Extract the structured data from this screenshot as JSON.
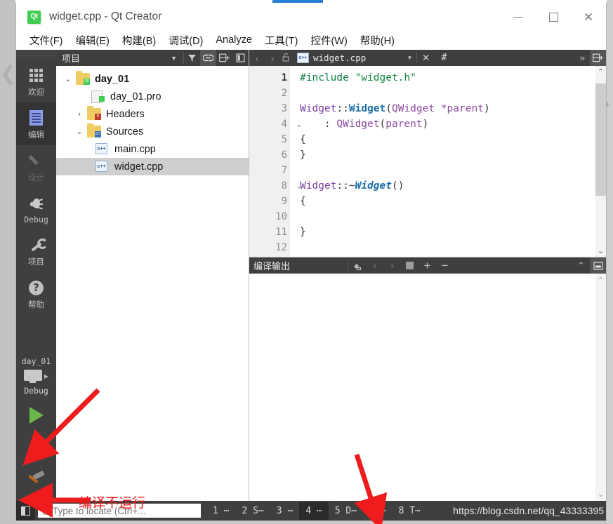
{
  "window": {
    "title": "widget.cpp - Qt Creator",
    "logo_text": "Qt",
    "minimize": "—",
    "maximize": "□",
    "close": "✕"
  },
  "menubar": {
    "items": [
      {
        "label": "文件(F)"
      },
      {
        "label": "编辑(E)"
      },
      {
        "label": "构建(B)"
      },
      {
        "label": "调试(D)"
      },
      {
        "label": "Analyze"
      },
      {
        "label": "工具(T)"
      },
      {
        "label": "控件(W)"
      },
      {
        "label": "帮助(H)"
      }
    ]
  },
  "modebar": {
    "modes": [
      {
        "label": "欢迎",
        "icon": "grid-icon",
        "state": "normal"
      },
      {
        "label": "编辑",
        "icon": "document-icon",
        "state": "active"
      },
      {
        "label": "设计",
        "icon": "pencil-icon",
        "state": "disabled"
      },
      {
        "label": "Debug",
        "icon": "bug-icon",
        "state": "normal"
      },
      {
        "label": "项目",
        "icon": "wrench-icon",
        "state": "normal"
      },
      {
        "label": "帮助",
        "icon": "question-circle-icon",
        "state": "normal"
      }
    ],
    "kit": {
      "project": "day_01",
      "target_icon": "monitor-icon",
      "build_config": "Debug",
      "run_label": "运行",
      "debug_label": "开始调试",
      "build_label": "构建"
    }
  },
  "project_panel": {
    "title": "项目",
    "toolbar": [
      {
        "name": "filter-icon",
        "label": "▼"
      },
      {
        "name": "link-icon",
        "label": "⛓",
        "active": true
      },
      {
        "name": "split-add-icon",
        "label": "⊟+"
      },
      {
        "name": "collapse-icon",
        "label": "◧"
      }
    ],
    "tree": [
      {
        "indent": 0,
        "twisty": "⌄",
        "icon": "folder-qt-icon",
        "label": "day_01",
        "bold": true,
        "selected": false
      },
      {
        "indent": 1,
        "twisty": "",
        "icon": "file-pro-icon",
        "label": "day_01.pro",
        "bold": false,
        "selected": false
      },
      {
        "indent": 1,
        "twisty": "›",
        "icon": "folder-h-icon",
        "label": "Headers",
        "bold": false,
        "selected": false
      },
      {
        "indent": 1,
        "twisty": "⌄",
        "icon": "folder-cpp-icon",
        "label": "Sources",
        "bold": false,
        "selected": false
      },
      {
        "indent": 2,
        "twisty": "",
        "icon": "file-cpp-icon",
        "label": "main.cpp",
        "bold": false,
        "selected": false
      },
      {
        "indent": 2,
        "twisty": "",
        "icon": "file-cpp-icon",
        "label": "widget.cpp",
        "bold": false,
        "selected": true
      }
    ]
  },
  "editor": {
    "toolbar": {
      "back": "‹",
      "forward": "›",
      "lock_icon": "unlock-icon",
      "file_icon": "cpp-file-icon",
      "filename": "widget.cpp",
      "dropdown": "▾",
      "close": "✕",
      "symbol": "#",
      "overflow": "»",
      "split": "⊟+"
    },
    "lines": [
      {
        "num": "1",
        "fold": "",
        "current": true,
        "tokens": [
          {
            "t": "#include ",
            "c": "k-pre"
          },
          {
            "t": "\"widget.h\"",
            "c": "k-str"
          }
        ]
      },
      {
        "num": "2",
        "fold": "",
        "current": false,
        "tokens": []
      },
      {
        "num": "3",
        "fold": "",
        "current": false,
        "tokens": [
          {
            "t": "Widget",
            "c": "k-type"
          },
          {
            "t": "::",
            "c": "k-op"
          },
          {
            "t": "Widget",
            "c": "k-fn"
          },
          {
            "t": "(",
            "c": "k-pl"
          },
          {
            "t": "QWidget ",
            "c": "k-arg"
          },
          {
            "t": "*parent",
            "c": "k-arg"
          },
          {
            "t": ")",
            "c": "k-pl"
          }
        ]
      },
      {
        "num": "4",
        "fold": "⌄",
        "current": false,
        "tokens": [
          {
            "t": "    : ",
            "c": "k-op"
          },
          {
            "t": "QWidget",
            "c": "k-arg"
          },
          {
            "t": "(",
            "c": "k-pl"
          },
          {
            "t": "parent",
            "c": "k-arg"
          },
          {
            "t": ")",
            "c": "k-pl"
          }
        ]
      },
      {
        "num": "5",
        "fold": "",
        "current": false,
        "tokens": [
          {
            "t": "{",
            "c": "k-pl"
          }
        ]
      },
      {
        "num": "6",
        "fold": "",
        "current": false,
        "tokens": [
          {
            "t": "}",
            "c": "k-pl"
          }
        ]
      },
      {
        "num": "7",
        "fold": "",
        "current": false,
        "tokens": []
      },
      {
        "num": "8",
        "fold": "⌄",
        "current": false,
        "tokens": [
          {
            "t": "Widget",
            "c": "k-type"
          },
          {
            "t": "::~",
            "c": "k-op"
          },
          {
            "t": "Widget",
            "c": "k-dtor"
          },
          {
            "t": "()",
            "c": "k-pl"
          }
        ]
      },
      {
        "num": "9",
        "fold": "",
        "current": false,
        "tokens": [
          {
            "t": "{",
            "c": "k-pl"
          }
        ]
      },
      {
        "num": "10",
        "fold": "",
        "current": false,
        "tokens": []
      },
      {
        "num": "11",
        "fold": "",
        "current": false,
        "tokens": [
          {
            "t": "}",
            "c": "k-pl"
          }
        ]
      },
      {
        "num": "12",
        "fold": "",
        "current": false,
        "tokens": []
      }
    ],
    "scroll": {
      "up": "⌃",
      "down": "⌄"
    }
  },
  "output_panel": {
    "title": "编译输出",
    "buttons": [
      {
        "name": "clear-icon",
        "label": "🧹"
      },
      {
        "name": "prev-icon",
        "label": "‹"
      },
      {
        "name": "next-icon",
        "label": "›"
      },
      {
        "name": "stop-icon",
        "label": "■"
      },
      {
        "name": "zoom-in-icon",
        "label": "+"
      },
      {
        "name": "zoom-out-icon",
        "label": "−"
      }
    ],
    "collapse": "⌃",
    "maximize": "▣",
    "content": ""
  },
  "statusbar": {
    "sidebar_toggle": "◧",
    "locator_placeholder": "Type to locate (Ctrl+...",
    "locator_value": "",
    "items": [
      {
        "label": "1 ⋯",
        "active": false
      },
      {
        "label": "2 S⋯",
        "active": false
      },
      {
        "label": "3 ⋯",
        "active": false
      },
      {
        "label": "4 ⋯",
        "active": true
      },
      {
        "label": "5 D⋯",
        "active": false
      },
      {
        "label": "6 ⋯",
        "active": false
      },
      {
        "label": "8 T⋯",
        "active": false
      }
    ]
  },
  "watermark": {
    "text": "https://blog.csdn.net/qq_43333395"
  },
  "annotations": {
    "note_text": "编译不运行",
    "arrow_color": "#ee1c1c"
  }
}
